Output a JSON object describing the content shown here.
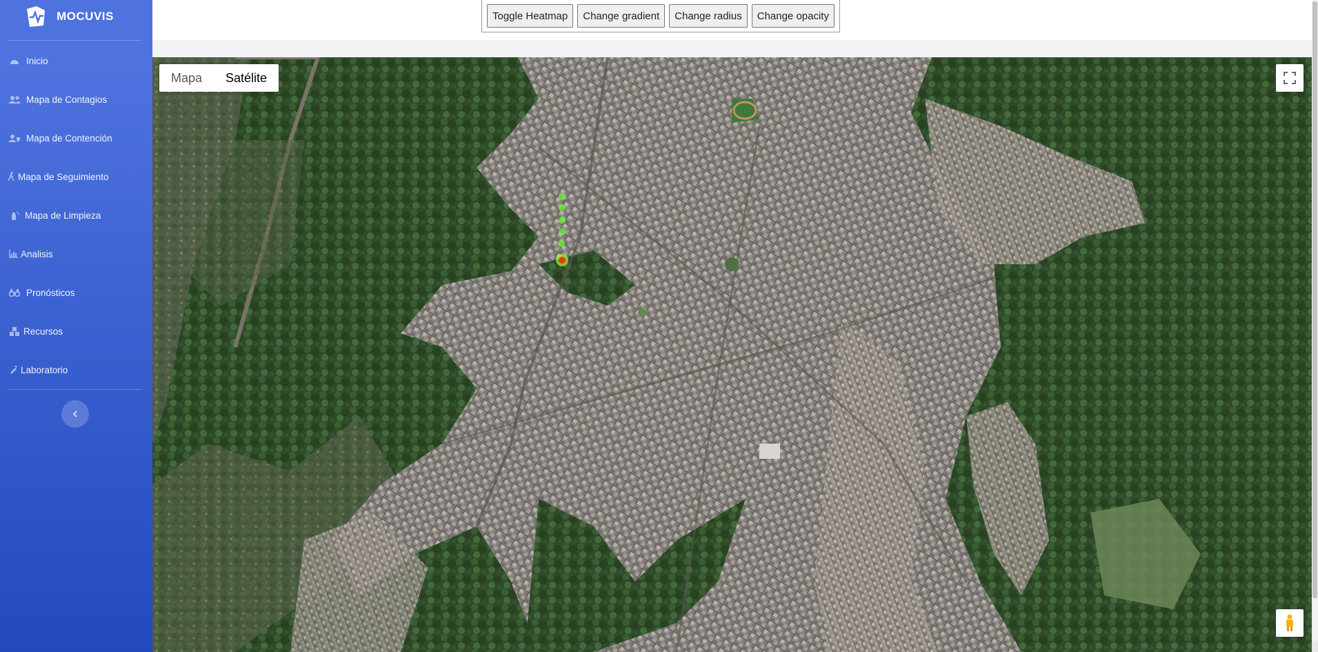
{
  "brand": {
    "name": "MOCUVIS"
  },
  "sidebar": {
    "items": [
      {
        "label": "Inicio",
        "icon": "tachometer-icon"
      },
      {
        "label": "Mapa de Contagios",
        "icon": "users-icon"
      },
      {
        "label": "Mapa de Contención",
        "icon": "user-shield-icon"
      },
      {
        "label": "Mapa de Seguimiento",
        "icon": "walking-icon"
      },
      {
        "label": "Mapa de Limpieza",
        "icon": "spray-icon"
      },
      {
        "label": "Analisis",
        "icon": "chart-icon"
      },
      {
        "label": "Pronósticos",
        "icon": "binoculars-icon"
      },
      {
        "label": "Recursos",
        "icon": "cubes-icon"
      },
      {
        "label": "Laboratorio",
        "icon": "flask-icon"
      }
    ]
  },
  "toolbar": {
    "toggle_heatmap": "Toggle Heatmap",
    "change_gradient": "Change gradient",
    "change_radius": "Change radius",
    "change_opacity": "Change opacity"
  },
  "map": {
    "type_map": "Mapa",
    "type_satellite": "Satélite",
    "selected_type": "Satélite",
    "heat_colors": {
      "low": "#66ff33",
      "high": "#ff2a00"
    }
  },
  "colors": {
    "sidebar_top": "#4e73df",
    "sidebar_bottom": "#224abe"
  }
}
